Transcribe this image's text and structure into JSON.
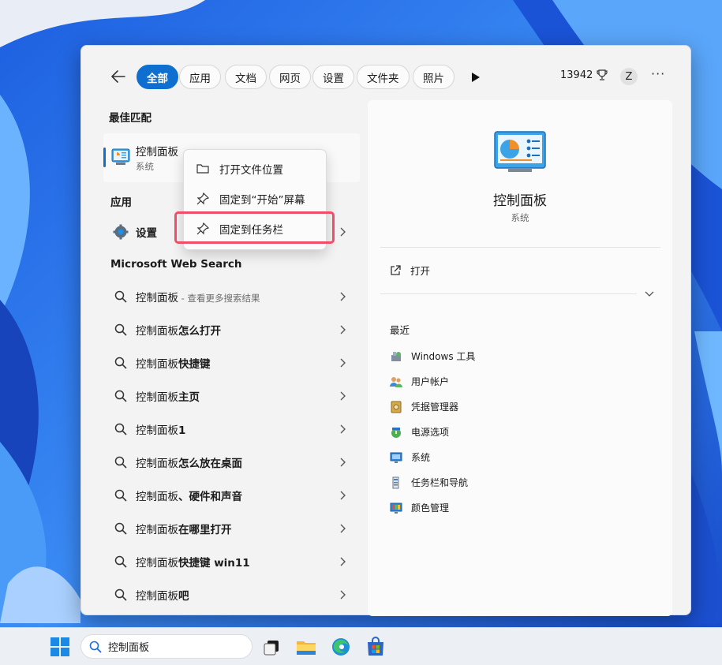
{
  "filters": {
    "back_label": "←",
    "tabs": [
      "全部",
      "应用",
      "文档",
      "网页",
      "设置",
      "文件夹",
      "照片"
    ],
    "points": "13942",
    "avatar_initial": "Z",
    "more": "···"
  },
  "best_match": {
    "section_label": "最佳匹配",
    "title": "控制面板",
    "subtitle": "系统"
  },
  "apps": {
    "section_label": "应用",
    "items": [
      {
        "label": "设置"
      }
    ]
  },
  "web": {
    "section_label": "Microsoft Web Search",
    "results": [
      {
        "prefix": "控制面板",
        "suffix": "",
        "hint": " - 查看更多搜索结果"
      },
      {
        "prefix": "控制面板",
        "suffix": "怎么打开",
        "hint": ""
      },
      {
        "prefix": "控制面板",
        "suffix": "快捷键",
        "hint": ""
      },
      {
        "prefix": "控制面板",
        "suffix": "主页",
        "hint": ""
      },
      {
        "prefix": "控制面板",
        "suffix": "1",
        "hint": ""
      },
      {
        "prefix": "控制面板",
        "suffix": "怎么放在桌面",
        "hint": ""
      },
      {
        "prefix": "控制面板",
        "suffix": "、硬件和声音",
        "hint": ""
      },
      {
        "prefix": "控制面板",
        "suffix": "在哪里打开",
        "hint": ""
      },
      {
        "prefix": "控制面板",
        "suffix": "快捷键 win11",
        "hint": ""
      },
      {
        "prefix": "控制面板",
        "suffix": "吧",
        "hint": ""
      }
    ]
  },
  "context_menu": {
    "items": [
      {
        "label": "打开文件位置",
        "icon": "folder-icon"
      },
      {
        "label": "固定到“开始”屏幕",
        "icon": "pin-icon"
      },
      {
        "label": "固定到任务栏",
        "icon": "pin-icon"
      }
    ]
  },
  "detail": {
    "title": "控制面板",
    "subtitle": "系统",
    "open_label": "打开",
    "recent_label": "最近",
    "recent": [
      {
        "label": "Windows 工具",
        "icon": "windows-tools-icon"
      },
      {
        "label": "用户帐户",
        "icon": "user-accounts-icon"
      },
      {
        "label": "凭据管理器",
        "icon": "credential-manager-icon"
      },
      {
        "label": "电源选项",
        "icon": "power-options-icon"
      },
      {
        "label": "系统",
        "icon": "system-icon"
      },
      {
        "label": "任务栏和导航",
        "icon": "taskbar-navigation-icon"
      },
      {
        "label": "颜色管理",
        "icon": "color-management-icon"
      }
    ]
  },
  "taskbar": {
    "search_value": "控制面板"
  },
  "colors": {
    "accent": "#0f6fd0",
    "highlight": "#ef4d6a"
  }
}
